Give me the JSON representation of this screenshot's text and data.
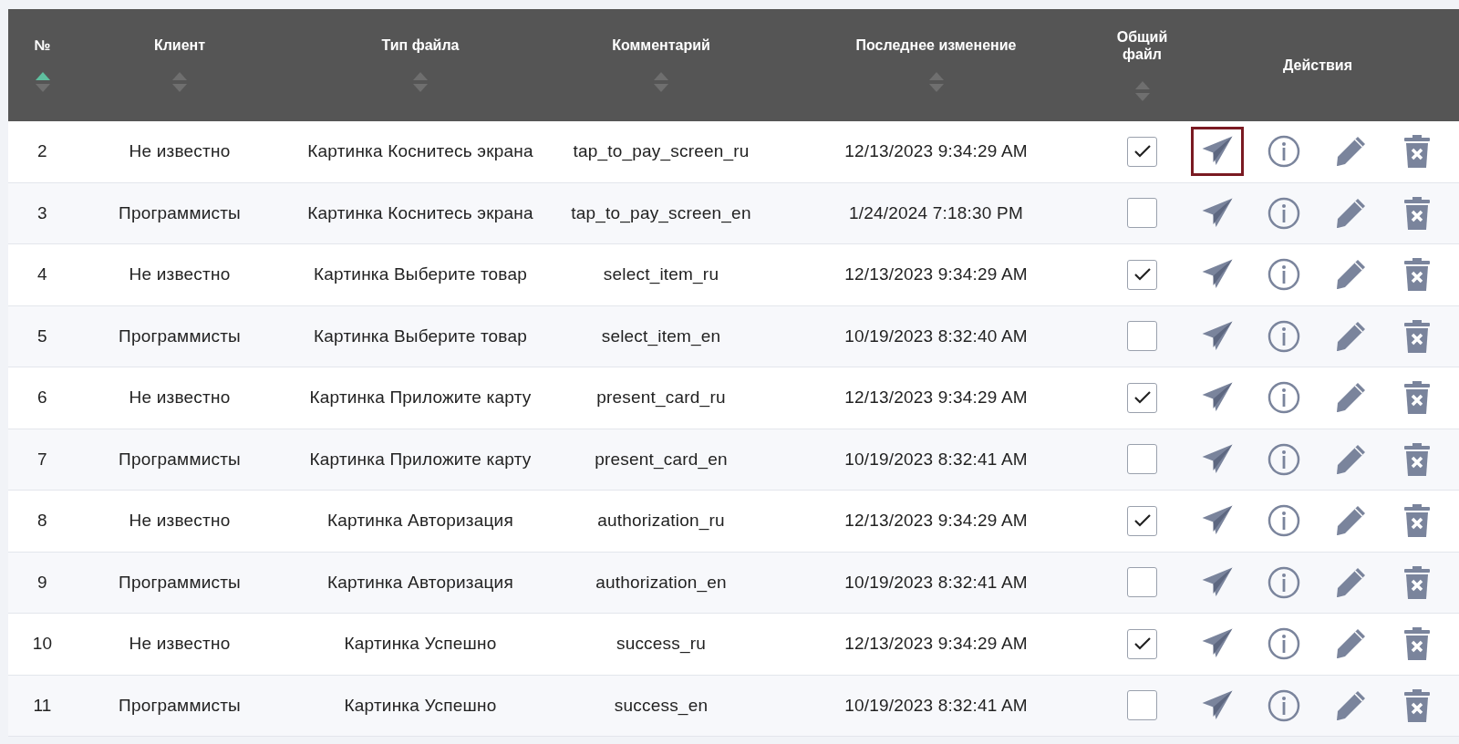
{
  "columns": [
    {
      "label": "№",
      "sorted": true
    },
    {
      "label": "Клиент",
      "sorted": false
    },
    {
      "label": "Тип файла",
      "sorted": false
    },
    {
      "label": "Комментарий",
      "sorted": false
    },
    {
      "label": "Последнее изменение",
      "sorted": false
    },
    {
      "label": "Общий файл",
      "sorted": false
    },
    {
      "label": "Действия"
    }
  ],
  "rows": [
    {
      "no": "2",
      "client": "Не известно",
      "file_type": "Картинка Коснитесь экрана",
      "comment": "tap_to_pay_screen_ru",
      "modified": "12/13/2023 9:34:29 AM",
      "shared": true,
      "send_focused": true
    },
    {
      "no": "3",
      "client": "Программисты",
      "file_type": "Картинка Коснитесь экрана",
      "comment": "tap_to_pay_screen_en",
      "modified": "1/24/2024 7:18:30 PM",
      "shared": false,
      "send_focused": false
    },
    {
      "no": "4",
      "client": "Не известно",
      "file_type": "Картинка Выберите товар",
      "comment": "select_item_ru",
      "modified": "12/13/2023 9:34:29 AM",
      "shared": true,
      "send_focused": false
    },
    {
      "no": "5",
      "client": "Программисты",
      "file_type": "Картинка Выберите товар",
      "comment": "select_item_en",
      "modified": "10/19/2023 8:32:40 AM",
      "shared": false,
      "send_focused": false
    },
    {
      "no": "6",
      "client": "Не известно",
      "file_type": "Картинка Приложите карту",
      "comment": "present_card_ru",
      "modified": "12/13/2023 9:34:29 AM",
      "shared": true,
      "send_focused": false
    },
    {
      "no": "7",
      "client": "Программисты",
      "file_type": "Картинка Приложите карту",
      "comment": "present_card_en",
      "modified": "10/19/2023 8:32:41 AM",
      "shared": false,
      "send_focused": false
    },
    {
      "no": "8",
      "client": "Не известно",
      "file_type": "Картинка Авторизация",
      "comment": "authorization_ru",
      "modified": "12/13/2023 9:34:29 AM",
      "shared": true,
      "send_focused": false
    },
    {
      "no": "9",
      "client": "Программисты",
      "file_type": "Картинка Авторизация",
      "comment": "authorization_en",
      "modified": "10/19/2023 8:32:41 AM",
      "shared": false,
      "send_focused": false
    },
    {
      "no": "10",
      "client": "Не известно",
      "file_type": "Картинка Успешно",
      "comment": "success_ru",
      "modified": "12/13/2023 9:34:29 AM",
      "shared": true,
      "send_focused": false
    },
    {
      "no": "11",
      "client": "Программисты",
      "file_type": "Картинка Успешно",
      "comment": "success_en",
      "modified": "10/19/2023 8:32:41 AM",
      "shared": false,
      "send_focused": false
    }
  ]
}
